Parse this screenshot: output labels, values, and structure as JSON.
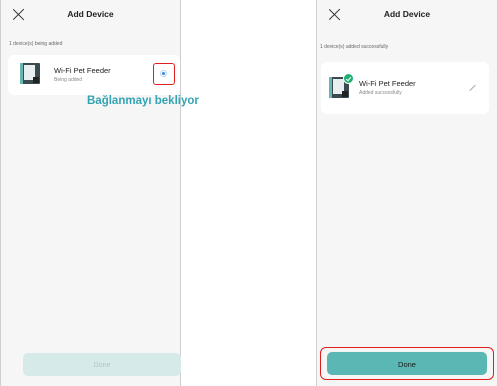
{
  "colors": {
    "accent": "#5bb7b3",
    "highlight": "#e01e1e",
    "caption": "#33a3b3",
    "success": "#20b070"
  },
  "left_screen": {
    "title": "Add Device",
    "status": "1 device(s) being added",
    "device": {
      "name": "Wi-Fi Pet Feeder",
      "status": "Being added"
    },
    "done_label": "Done"
  },
  "caption": "Bağlanmayı bekliyor",
  "right_screen": {
    "title": "Add Device",
    "status": "1 device(s) added successfully",
    "device": {
      "name": "Wi-Fi Pet Feeder",
      "status": "Added successfully"
    },
    "done_label": "Done"
  },
  "icons": {
    "close": "close-icon",
    "spinner": "loading-spinner-icon",
    "check": "check-badge-icon",
    "edit": "pencil-icon"
  }
}
